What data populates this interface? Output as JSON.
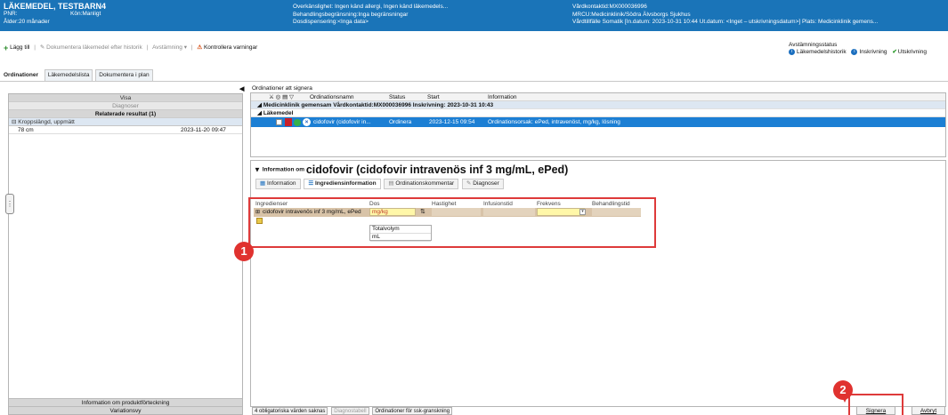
{
  "patient": {
    "name": "LÄKEMEDEL, TESTBARN4",
    "pnr": "PNR:",
    "sex": "Kön:Manligt",
    "age": "Ålder:20 månader",
    "allergy": "Överkänslighet: Ingen känd allergi, Ingen känd läkemedels...",
    "limits": "Behandlingsbegränsning:Inga begränsningar",
    "dispensing": "Dosdispensering:<Inga data>",
    "contact": "Vårdkontaktid:MX000036996",
    "mrcu": "MRCU:Medicinklinik/Södra Älvsborgs Sjukhus",
    "care": "Vårdtillfälle Somatik [In.datum: 2023-10-31 10:44 Ut.datum: <Inget – utskrivningsdatum>] Plats: Medicinklinik gemens..."
  },
  "toolbar": {
    "add": "Lägg till",
    "document_history": "Dokumentera läkemedel efter historik",
    "reconcile": "Avstämning",
    "check_warnings": "Kontrollera varningar"
  },
  "reconciliation": {
    "title": "Avstämningsstatus",
    "history": "Läkemedelshistorik",
    "admission": "Inskrivning",
    "discharge": "Utskrivning"
  },
  "tabs": [
    "Ordinationer",
    "Läkemedelslista",
    "Dokumentera i plan"
  ],
  "left": {
    "visa": "Visa",
    "diagnoser": "Diagnoser",
    "related": "Relaterade resultat (1)",
    "group": "Kroppslängd, uppmätt",
    "value": "78 cm",
    "date": "2023-11-20 09:47",
    "footer1": "Information om produktförteckning",
    "footer2": "Variationsvy"
  },
  "orders": {
    "label": "Ordinationer att signera",
    "col_name": "Ordinationsnamn",
    "col_status": "Status",
    "col_start": "Start",
    "col_info": "Information",
    "group1": "Medicinklinik gemensam  Vårdkontaktid:MX000036996  Inskrivning: 2023-10-31 10:43",
    "group2": "Läkemedel",
    "row_name": "cidofovir (cidofovir in...",
    "row_status": "Ordinera",
    "row_start": "2023-12-15 09:54",
    "row_info": "Ordinationsorsak: ePed, intravenöst, mg/kg, lösning"
  },
  "info": {
    "prefix": "Information om",
    "drug": "cidofovir (cidofovir intravenös inf 3 mg/mL, ePed)",
    "tabs": [
      "Information",
      "Ingrediensinformation",
      "Ordinationskommentar",
      "Diagnoser"
    ]
  },
  "ingredients": {
    "headers": [
      "Ingredienser",
      "Dos",
      "Hastighet",
      "Infusionstid",
      "Frekvens",
      "Behandlingstid"
    ],
    "row_name": "cidofovir intravenös inf 3 mg/mL, ePed",
    "dose_unit": "mg/kg",
    "total_label": "Totalvolym",
    "total_unit": "mL"
  },
  "bottom": {
    "missing": "4 obligatoriska värden saknas",
    "diagnostabell": "Diagnostabell",
    "review": "Ordinationer för ssk-granskning",
    "sign": "Signera",
    "cancel": "Avbryt"
  },
  "badges": [
    "1",
    "2"
  ],
  "colors": {
    "header": "#1a74b8",
    "selected": "#1c7fd4",
    "highlight": "#de3a3a"
  }
}
